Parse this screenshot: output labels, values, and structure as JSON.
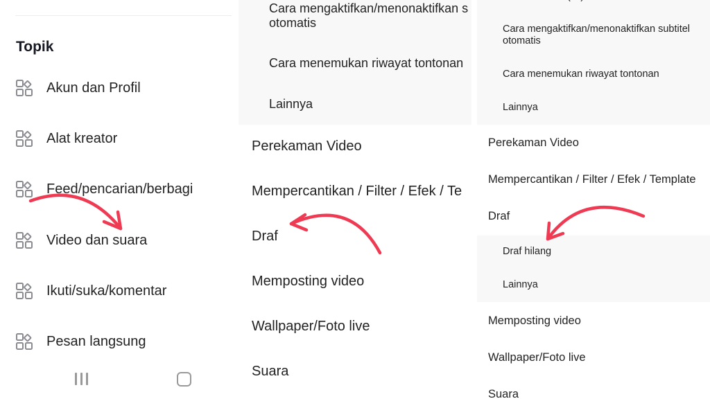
{
  "accent_color": "#ee3a52",
  "left_panel": {
    "heading": "Topik",
    "topics": [
      {
        "label": "Akun dan Profil",
        "icon": "category-grid-icon"
      },
      {
        "label": "Alat kreator",
        "icon": "category-grid-icon"
      },
      {
        "label": "Feed/pencarian/berbagi",
        "icon": "category-grid-icon"
      },
      {
        "label": "Video dan suara",
        "icon": "category-grid-icon"
      },
      {
        "label": "Ikuti/suka/komentar",
        "icon": "category-grid-icon"
      },
      {
        "label": "Pesan langsung",
        "icon": "category-grid-icon"
      }
    ],
    "nav_icons": [
      "recent-apps-icon",
      "home-icon"
    ]
  },
  "middle_panel": {
    "sub_items": [
      "Cara mengaktifkan/menonaktifkan subtitel otomatis",
      "Cara menemukan riwayat tontonan",
      "Lainnya"
    ],
    "sub_item_0_line1": "Cara mengaktifkan/menonaktifkan s",
    "sub_item_0_line2": "otomatis",
    "sections": [
      "Perekaman Video",
      "Mempercantikan / Filter / Efek / Te",
      "Draf",
      "Memposting video",
      "Wallpaper/Foto live",
      "Suara"
    ]
  },
  "right_panel": {
    "top_partial": "(…)",
    "sub_items": [
      "Cara mengaktifkan/menonaktifkan subtitel otomatis",
      "Cara menemukan riwayat tontonan",
      "Lainnya"
    ],
    "sub_item_0_line1": "Cara mengaktifkan/menonaktifkan subtitel",
    "sub_item_0_line2": "otomatis",
    "sections_before": [
      "Perekaman Video",
      "Mempercantikan / Filter / Efek / Template",
      "Draf"
    ],
    "draf_sub_items": [
      "Draf hilang",
      "Lainnya"
    ],
    "sections_after": [
      "Memposting video",
      "Wallpaper/Foto live",
      "Suara"
    ]
  }
}
